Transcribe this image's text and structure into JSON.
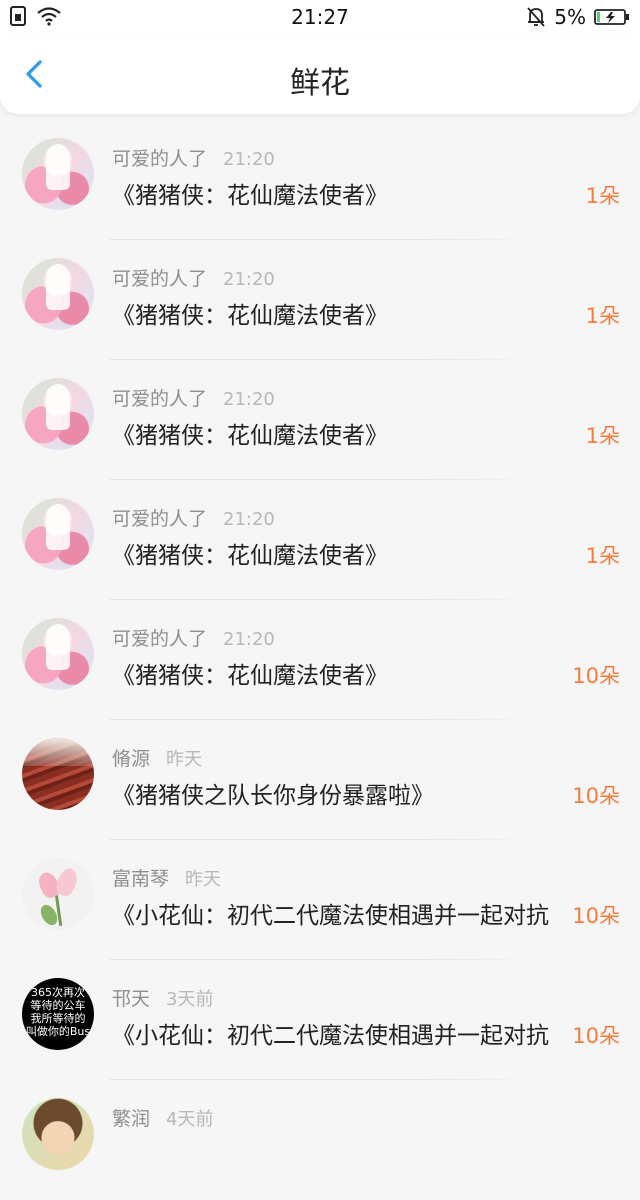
{
  "status_bar": {
    "time": "21:27",
    "battery": "5%",
    "icons": [
      "sim-icon",
      "wifi-icon",
      "mute-bell-icon",
      "battery-charging-icon"
    ]
  },
  "header": {
    "title": "鲜花",
    "back_icon": "chevron-left-icon"
  },
  "colors": {
    "accent": "#2a9cf0",
    "count": "#f67c3c",
    "name": "#8f8f8f",
    "time": "#b8b8b8"
  },
  "items": [
    {
      "name": "可爱的人了",
      "time": "21:20",
      "title": "《猪猪侠：花仙魔法使者》",
      "count": "1朵",
      "avatar": "anime"
    },
    {
      "name": "可爱的人了",
      "time": "21:20",
      "title": "《猪猪侠：花仙魔法使者》",
      "count": "1朵",
      "avatar": "anime"
    },
    {
      "name": "可爱的人了",
      "time": "21:20",
      "title": "《猪猪侠：花仙魔法使者》",
      "count": "1朵",
      "avatar": "anime"
    },
    {
      "name": "可爱的人了",
      "time": "21:20",
      "title": "《猪猪侠：花仙魔法使者》",
      "count": "1朵",
      "avatar": "anime"
    },
    {
      "name": "可爱的人了",
      "time": "21:20",
      "title": "《猪猪侠：花仙魔法使者》",
      "count": "10朵",
      "avatar": "anime"
    },
    {
      "name": "脩源",
      "time": "昨天",
      "title": "《猪猪侠之队长你身份暴露啦》",
      "count": "10朵",
      "avatar": "wood"
    },
    {
      "name": "富南琴",
      "time": "昨天",
      "title": "《小花仙：初代二代魔法使相遇并一起对抗",
      "count": "10朵",
      "avatar": "tulip"
    },
    {
      "name": "邗天",
      "time": "3天前",
      "title": "《小花仙：初代二代魔法使相遇并一起对抗",
      "count": "10朵",
      "avatar": "blacktext",
      "avatar_text": [
        "365次再次",
        "等待的公车",
        "我所等待的",
        "叫做你的Bus"
      ]
    },
    {
      "name": "繁润",
      "time": "4天前",
      "title": "",
      "count": "",
      "avatar": "boy"
    }
  ]
}
